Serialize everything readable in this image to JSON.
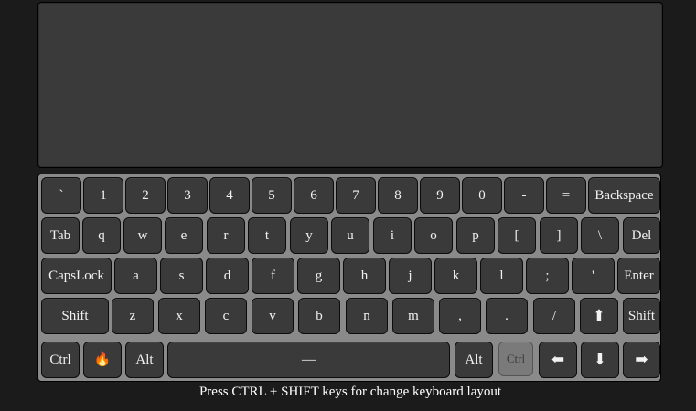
{
  "keyboard": {
    "row1": [
      "`",
      "1",
      "2",
      "3",
      "4",
      "5",
      "6",
      "7",
      "8",
      "9",
      "0",
      "-",
      "=",
      "Backspace"
    ],
    "row2": [
      "Tab",
      "q",
      "w",
      "e",
      "r",
      "t",
      "y",
      "u",
      "i",
      "o",
      "p",
      "[",
      "]",
      "\\",
      "Del"
    ],
    "row3": [
      "CapsLock",
      "a",
      "s",
      "d",
      "f",
      "g",
      "h",
      "j",
      "k",
      "l",
      ";",
      "'",
      "Enter"
    ],
    "row4": [
      "Shift",
      "z",
      "x",
      "c",
      "v",
      "b",
      "n",
      "m",
      ",",
      ".",
      "/",
      "⬆",
      "Shift"
    ],
    "row5": {
      "ctrl_left": "Ctrl",
      "emoji": "🔥",
      "alt_left": "Alt",
      "space": "—",
      "alt_right": "Alt",
      "ctrl_right": "Ctrl",
      "arrow_left": "⬅",
      "arrow_down": "⬇",
      "arrow_right": "➡"
    }
  },
  "hint": "Press CTRL + SHIFT keys for change keyboard layout"
}
